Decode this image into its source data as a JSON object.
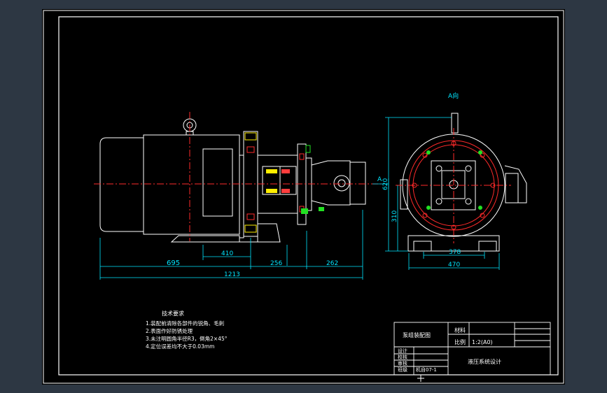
{
  "drawing": {
    "view_label": "A向",
    "dims": {
      "d695": "695",
      "d410": "410",
      "d256": "256",
      "d262": "262",
      "d1213": "1213",
      "d620": "620",
      "d310": "310",
      "d378": "378",
      "d470": "470"
    },
    "section_mark": "A"
  },
  "tech_requirements": {
    "title": "技术要求",
    "items": [
      "1.装配前清除各部件的锐角、毛刺",
      "2.表面作好防锈处理",
      "3.未注明圆角半径R3，倒角2×45°",
      "4.定位误差均不大于0.03mm"
    ]
  },
  "title_block": {
    "drawing_name": "泵组装配图",
    "material_label": "材料",
    "scale_label": "比例",
    "scale_value": "1:2(A0)",
    "project": "液压系统设计",
    "rows": [
      "设计",
      "校核",
      "审核",
      "班级"
    ],
    "class_value": "机自07-1"
  }
}
